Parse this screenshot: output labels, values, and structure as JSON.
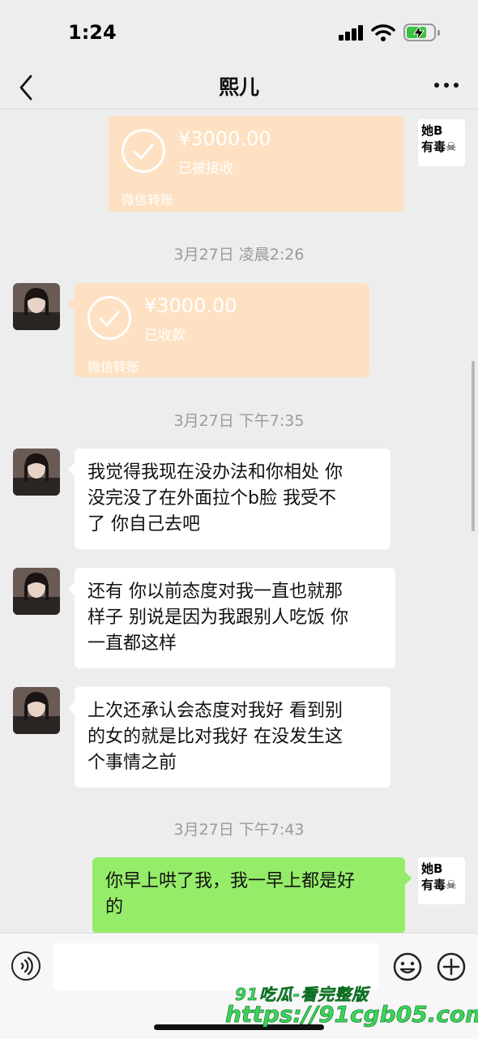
{
  "status_bar": {
    "time": "1:24"
  },
  "nav": {
    "title": "熙儿"
  },
  "self_avatar": {
    "line1": "她B",
    "line2": "有毒☠"
  },
  "messages": {
    "transfer_sent": {
      "amount": "¥3000.00",
      "status": "已被接收",
      "footer": "微信转账"
    },
    "ts1": "3月27日 凌晨2:26",
    "transfer_received": {
      "amount": "¥3000.00",
      "status": "已收款",
      "footer": "微信转账"
    },
    "ts2": "3月27日 下午7:35",
    "msg1": [
      "我觉得我现在没办法和你相处 你",
      "没完没了在外面拉个b脸 我受不",
      "了 你自己去吧"
    ],
    "msg2": [
      "还有 你以前态度对我一直也就那",
      "样子 别说是因为我跟别人吃饭 你",
      "一直都这样"
    ],
    "msg3": [
      "上次还承认会态度对我好 看到别",
      "的女的就是比对我好 在没发生这",
      "个事情之前"
    ],
    "ts3": "3月27日 下午7:43",
    "msg4": [
      "你早上哄了我，我一早上都是好",
      "的"
    ]
  },
  "watermark": {
    "line1": "91吃瓜-看完整版",
    "line2": "https://91cgb05.com"
  },
  "colors": {
    "transfer_bg": "#fde1c2",
    "self_bubble": "#95ec69",
    "chat_bg": "#ededed"
  }
}
